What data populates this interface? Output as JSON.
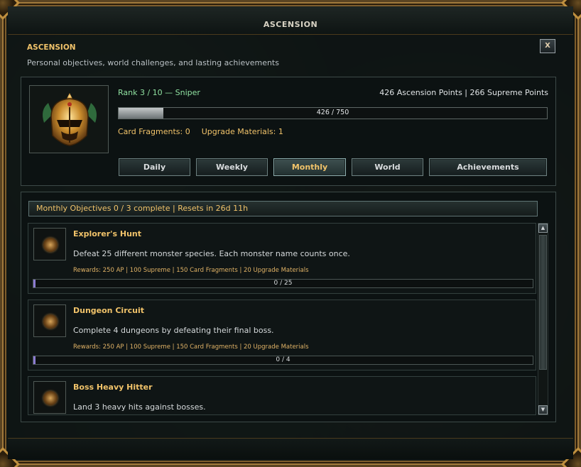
{
  "window": {
    "title": "ASCENSION"
  },
  "header": {
    "title": "ASCENSION",
    "subtitle": "Personal objectives, world challenges, and lasting achievements",
    "close_label": "X"
  },
  "profile": {
    "rank_text": "Rank 3 / 10 — Sniper",
    "points_text": "426 Ascension Points  |  266 Supreme Points",
    "progress": {
      "current": 426,
      "max": 750,
      "label": "426 / 750",
      "fill_fraction": 0.104
    },
    "card_fragments_text": "Card Fragments: 0",
    "upgrade_materials_text": "Upgrade Materials: 1",
    "emblem_icon": "golden-helmet-emblem-icon"
  },
  "tabs": [
    {
      "label": "Daily",
      "active": false
    },
    {
      "label": "Weekly",
      "active": false
    },
    {
      "label": "Monthly",
      "active": true
    },
    {
      "label": "World",
      "active": false
    },
    {
      "label": "Achievements",
      "active": false
    }
  ],
  "objectives": {
    "header": "Monthly Objectives  0 / 3 complete  |  Resets in 26d 11h",
    "items": [
      {
        "title": "Explorer's Hunt",
        "description": "Defeat 25 different monster species. Each monster name counts once.",
        "rewards": "Rewards: 250 AP  |  100 Supreme  |  150 Card Fragments  |  20 Upgrade Materials",
        "progress_label": "0 / 25",
        "progress_fraction": 0
      },
      {
        "title": "Dungeon Circuit",
        "description": "Complete 4 dungeons by defeating their final boss.",
        "rewards": "Rewards: 250 AP  |  100 Supreme  |  150 Card Fragments  |  20 Upgrade Materials",
        "progress_label": "0 / 4",
        "progress_fraction": 0
      },
      {
        "title": "Boss Heavy Hitter",
        "description": "Land 3 heavy hits against bosses."
      }
    ]
  },
  "scrollbar": {
    "up_icon": "▲",
    "down_icon": "▼"
  },
  "colors": {
    "gold_text": "#f1c36a",
    "rank_green": "#8fe0a0",
    "frame_bronze": "#a17a3c",
    "progress_accent": "#8b7bd1"
  }
}
